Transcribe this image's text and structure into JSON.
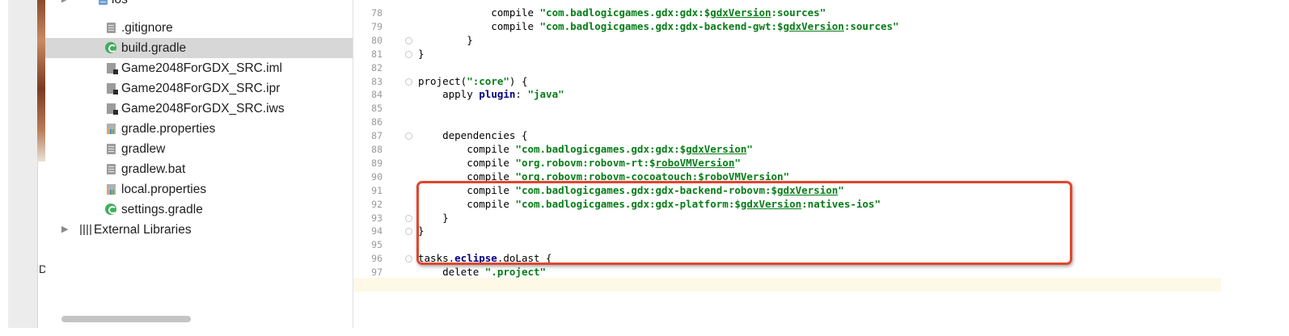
{
  "project_tree": {
    "top_item": "ios",
    "items": [
      {
        "label": ".gitignore",
        "icon": "text-file-icon",
        "selected": false
      },
      {
        "label": "build.gradle",
        "icon": "gradle-file-icon",
        "selected": true
      },
      {
        "label": "Game2048ForGDX_SRC.iml",
        "icon": "module-file-icon",
        "selected": false
      },
      {
        "label": "Game2048ForGDX_SRC.ipr",
        "icon": "module-file-icon",
        "selected": false
      },
      {
        "label": "Game2048ForGDX_SRC.iws",
        "icon": "module-file-icon",
        "selected": false
      },
      {
        "label": "gradle.properties",
        "icon": "properties-file-icon",
        "selected": false
      },
      {
        "label": "gradlew",
        "icon": "text-file-icon",
        "selected": false
      },
      {
        "label": "gradlew.bat",
        "icon": "text-file-icon",
        "selected": false
      },
      {
        "label": "local.properties",
        "icon": "properties-file-icon",
        "selected": false
      },
      {
        "label": "settings.gradle",
        "icon": "gradle-file-icon",
        "selected": false
      }
    ],
    "external_libraries": "External Libraries"
  },
  "left_panel_fragment": "DX",
  "editor": {
    "lines": [
      {
        "num": "78",
        "text": "            compile \"com.badlogicgames.gdx:gdx:$gdxVersion:sources\""
      },
      {
        "num": "79",
        "text": "            compile \"com.badlogicgames.gdx:gdx-backend-gwt:$gdxVersion:sources\""
      },
      {
        "num": "80",
        "text": "        }"
      },
      {
        "num": "81",
        "text": "}"
      },
      {
        "num": "82",
        "text": ""
      },
      {
        "num": "83",
        "text": "project(\":core\") {"
      },
      {
        "num": "84",
        "text": "    apply plugin: \"java\""
      },
      {
        "num": "85",
        "text": ""
      },
      {
        "num": "86",
        "text": ""
      },
      {
        "num": "87",
        "text": "    dependencies {"
      },
      {
        "num": "88",
        "text": "        compile \"com.badlogicgames.gdx:gdx:$gdxVersion\""
      },
      {
        "num": "89",
        "text": "        compile \"org.robovm:robovm-rt:$roboVMVersion\""
      },
      {
        "num": "90",
        "text": "        compile \"org.robovm:robovm-cocoatouch:$roboVMVersion\""
      },
      {
        "num": "91",
        "text": "        compile \"com.badlogicgames.gdx:gdx-backend-robovm:$gdxVersion\""
      },
      {
        "num": "92",
        "text": "        compile \"com.badlogicgames.gdx:gdx-platform:$gdxVersion:natives-ios\""
      },
      {
        "num": "93",
        "text": "    }"
      },
      {
        "num": "94",
        "text": "}"
      },
      {
        "num": "95",
        "text": ""
      },
      {
        "num": "96",
        "text": "tasks.eclipse.doLast {"
      },
      {
        "num": "97",
        "text": "    delete \".project\""
      }
    ],
    "current_line": "95",
    "highlight_lines": [
      "89",
      "90",
      "91",
      "92",
      "93"
    ]
  },
  "colors": {
    "string": "#067d17",
    "keyword": "#000080",
    "highlight_border": "#e0462e",
    "caret_row": "#fdf9e6",
    "selection": "#d7d7d7"
  }
}
